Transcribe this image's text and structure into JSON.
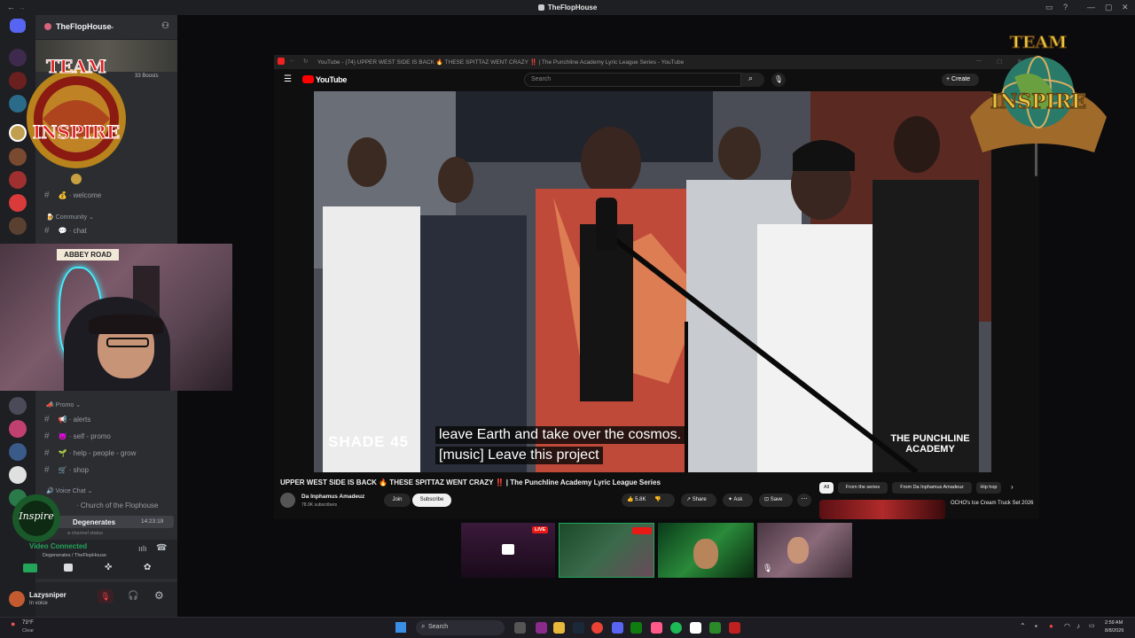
{
  "window": {
    "title": "TheFlopHouse"
  },
  "discord": {
    "server_name": "TheFlopHouse",
    "boosts": "33 Boosts",
    "channels_top": [
      {
        "emoji": "💰",
        "name": "welcome"
      }
    ],
    "category_community": "Community",
    "channels_community": [
      {
        "emoji": "💬",
        "name": "chat"
      }
    ],
    "category_promo": "Promo",
    "channels_promo": [
      {
        "emoji": "📢",
        "name": "alerts"
      },
      {
        "emoji": "😈",
        "name": "self - promo"
      },
      {
        "emoji": "🌱",
        "name": "help - people - grow"
      },
      {
        "emoji": "🛒",
        "name": "shop"
      }
    ],
    "category_voice": "Voice Chat",
    "voice_channels": [
      {
        "name": "Church of the Flophouse"
      },
      {
        "name": "Degenerates",
        "time": "14:23:19"
      }
    ],
    "channel_status_placeholder": "a channel status",
    "voice_status": "Video Connected",
    "voice_location": "Degenerates / TheFlopHouse",
    "user": {
      "name": "Lazysniper",
      "status": "In voice"
    }
  },
  "webcam": {
    "sign": "ABBEY ROAD"
  },
  "logos": {
    "left_text": "TEAM INSPIRE",
    "right_text": "TEAM INSPIRE"
  },
  "browser": {
    "tab_title": "YouTube - (74) UPPER WEST SIDE IS BACK 🔥 THESE SPITTAZ WENT CRAZY ‼️ | The Punchline Academy Lyric League Series - YouTube"
  },
  "youtube": {
    "logo": "YouTube",
    "search_placeholder": "Search",
    "create_label": "Create",
    "subtitle_line1": "leave Earth and take over the cosmos.",
    "subtitle_line2": "[music] Leave this project",
    "watermark_left": "SHADE 45",
    "watermark_right": "THE PUNCHLINE ACADEMY",
    "video_title": "UPPER WEST SIDE IS BACK 🔥 THESE SPITTAZ WENT CRAZY ‼️ | The Punchline Academy Lyric League Series",
    "channel_name": "Da Inphamus Amadeuz",
    "subscribers": "78.9K subscribers",
    "join": "Join",
    "subscribe": "Subscribe",
    "likes": "5.8K",
    "share": "Share",
    "ask": "Ask",
    "save": "Save",
    "chips": [
      "All",
      "From the series",
      "From Da Inphamus Amadeuz",
      "Hip hop"
    ],
    "up_next_title": "OCHO's Ice Cream Truck Set 2026"
  },
  "streams": {
    "live_badge": "LIVE"
  },
  "taskbar": {
    "weather_temp": "73°F",
    "weather_desc": "Clear",
    "search": "Search",
    "time": "2:59 AM",
    "date": "8/8/2026"
  }
}
